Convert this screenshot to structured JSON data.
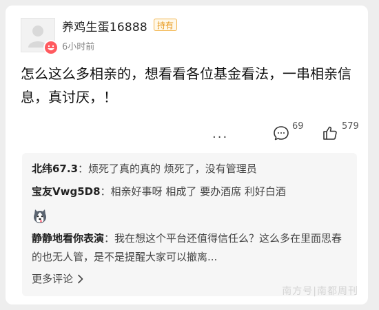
{
  "post": {
    "username": "养鸡生蛋16888",
    "badge": "持有",
    "time": "6小时前",
    "text": "怎么这么多相亲的，想看看各位基金看法，一串相亲信息，真讨厌，！",
    "more_label": "...",
    "comment_count": "69",
    "like_count": "579"
  },
  "comments": [
    {
      "user": "北纬67.3",
      "sep": "：",
      "text": "烦死了真的真的 烦死了，没有管理员"
    },
    {
      "user": "宝友Vwg5D8",
      "sep": "：",
      "text": "相亲好事呀 相成了 要办酒席 利好白酒"
    },
    {
      "user": "静静地看你表演",
      "sep": "：",
      "text": "我在想这个平台还值得信任么？这么多在里面思春的也无人管，是不是提醒大家可以撤离..."
    }
  ],
  "more_comments_label": "更多评论",
  "watermark": "南方号|南都周刊",
  "icons": {
    "avatar": "default-avatar-icon",
    "emoji": "grinning-face-icon",
    "comment": "comment-bubble-icon",
    "like": "thumbs-up-icon",
    "husky": "husky-emoji-icon",
    "chevron": "chevron-right-icon"
  },
  "colors": {
    "badge": "#e89a1f",
    "badge_bg": "#fff8e9",
    "emoji": "#ff5a5f"
  }
}
